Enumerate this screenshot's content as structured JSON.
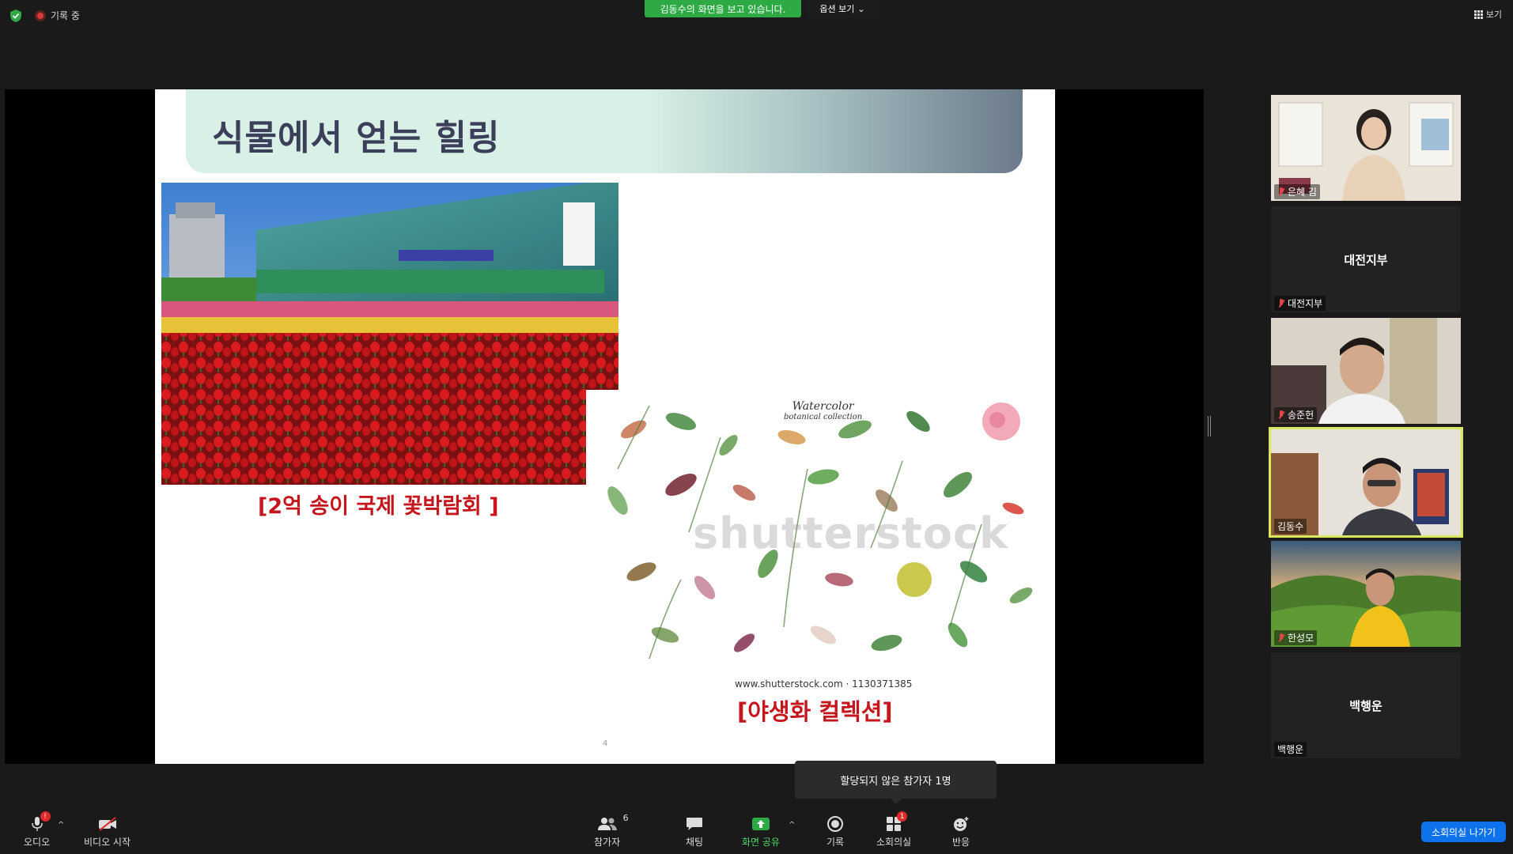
{
  "topbar": {
    "recording_label": "기록 중",
    "share_banner": "김동수의 화면을 보고 있습니다.",
    "view_options": "옵션 보기",
    "view_label": "보기"
  },
  "slide": {
    "title": "식물에서 얻는 힐링",
    "caption_left": "[2억 송이 국제 꽃박람회 ]",
    "botanical_title_1": "Watercolor",
    "botanical_title_2": "botanical collection",
    "watermark": "shutterstock",
    "source_url": "www.shutterstock.com · 1130371385",
    "caption_right": "[야생화 컬렉션]",
    "page_number": "4"
  },
  "participants": [
    {
      "name": "은혜 김",
      "muted": true,
      "video": true
    },
    {
      "name": "대전지부",
      "display": "대전지부",
      "muted": true,
      "video": false
    },
    {
      "name": "송준헌",
      "muted": true,
      "video": true
    },
    {
      "name": "김동수",
      "muted": false,
      "video": true,
      "active": true
    },
    {
      "name": "한성모",
      "muted": true,
      "video": true
    },
    {
      "name": "백행운",
      "display": "백행운",
      "muted": false,
      "video": false
    }
  ],
  "tooltip": "할당되지 않은 참가자 1명",
  "toolbar": {
    "audio": {
      "label": "오디오",
      "badge": "!"
    },
    "video": {
      "label": "비디오 시작"
    },
    "participants": {
      "label": "참가자",
      "count": "6"
    },
    "chat": {
      "label": "채팅"
    },
    "share": {
      "label": "화면 공유"
    },
    "record": {
      "label": "기록"
    },
    "breakout": {
      "label": "소회의실",
      "badge": "1"
    },
    "reactions": {
      "label": "반응"
    },
    "leave": {
      "label": "소회의실 나가기"
    }
  },
  "colors": {
    "share_green": "#2eaa45",
    "leave_blue": "#0e72ed",
    "active_speaker": "#d7e85c",
    "caption_red": "#c4161c",
    "slide_title": "#3b3f5a"
  }
}
